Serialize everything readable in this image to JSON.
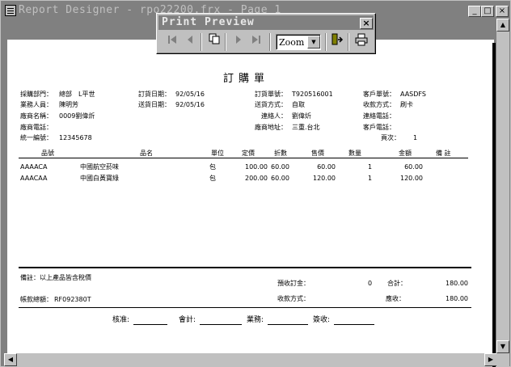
{
  "window": {
    "title": "Report Designer - rpo22200.frx - Page 1",
    "minimize": "_",
    "restore": "□",
    "close": "×"
  },
  "toolbar": {
    "title": "Print Preview",
    "close": "×",
    "first_icon": "first-page-icon",
    "prev_icon": "previous-page-icon",
    "goto_icon": "go-to-page-icon",
    "next_icon": "next-page-icon",
    "last_icon": "last-page-icon",
    "zoom_value": "Zoom",
    "exit_icon": "close-preview-icon",
    "print_icon": "print-icon"
  },
  "report": {
    "title": "訂購單",
    "header": {
      "dept_label": "採購部門：",
      "dept_value": "總部",
      "dept_extra": "L平世",
      "buyer_label": "業務人員：",
      "buyer_value": "陳明芳",
      "vendor_label": "廠商名稱：",
      "vendor_value": "0009劉偉炘",
      "vendor_tel_label": "廠商電話：",
      "tax_label": "統一編號：",
      "tax_value": "12345678",
      "order_date_label": "訂貨日期：",
      "order_date_value": "92/05/16",
      "delivery_date_label": "送貨日期：",
      "delivery_date_value": "92/05/16",
      "order_no_label": "訂貨單號：",
      "order_no_value": "T920516001",
      "ship_label": "送貨方式：",
      "ship_value": "自取",
      "contact_label": "連絡人：",
      "contact_value": "劉偉炘",
      "address_label": "廠商地址：",
      "address_value": "三重.台北",
      "cust_no_label": "客戶單號：",
      "cust_no_value": "AASDFS",
      "pay_label": "收款方式：",
      "pay_value": "刷卡",
      "contact_tel_label": "連絡電話：",
      "cust_tel_label": "客戶電話：",
      "page_label": "頁次：",
      "page_value": "1"
    },
    "columns": {
      "code": "品號",
      "name": "品名",
      "unit": "單位",
      "list_price": "定價",
      "discount": "折數",
      "price": "售價",
      "qty": "數量",
      "amount": "金額",
      "note": "備 註"
    },
    "rows": [
      {
        "code": "AAAACA",
        "name": "中國航空菸味",
        "unit": "包",
        "list_price": "100.00",
        "discount": "60.00",
        "price": "60.00",
        "qty": "1",
        "amount": "60.00"
      },
      {
        "code": "AAACAA",
        "name": "中國白黃寶綠",
        "unit": "包",
        "list_price": "200.00",
        "discount": "60.00",
        "price": "120.00",
        "qty": "1",
        "amount": "120.00"
      }
    ],
    "footer": {
      "remark": "備註：以上產品皆含稅價",
      "deposit_label": "預收訂金：",
      "deposit_value": "0",
      "subtotal_label": "合計：",
      "subtotal_value": "180.00",
      "account_label": "帳款總額：",
      "account_value": "RF092380T",
      "received_label": "收款方式：",
      "total_label": "應收：",
      "total_value": "180.00",
      "sign_check": "核准:",
      "sign_accounting": "會計:",
      "sign_sales": "業務:",
      "sign_receive": "簽收:"
    }
  }
}
